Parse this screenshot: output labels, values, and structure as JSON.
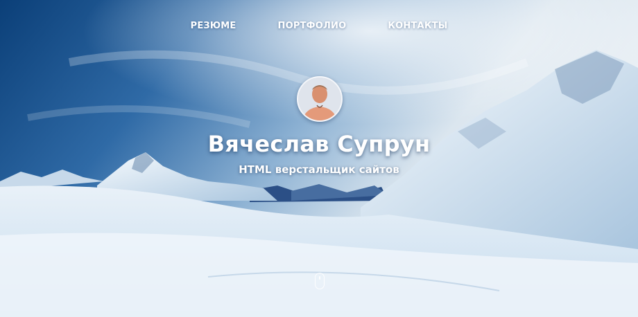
{
  "nav": {
    "items": [
      {
        "label": "РЕЗЮМЕ"
      },
      {
        "label": "ПОРТФОЛИО"
      },
      {
        "label": "КОНТАКТЫ"
      }
    ]
  },
  "profile": {
    "name": "Вячеслав Супрун",
    "role": "HTML верстальщик сайтов"
  },
  "colors": {
    "sky_dark": "#0b3f78",
    "sky_light": "#e6eef5",
    "snow": "#f2f7fc",
    "text": "#ffffff"
  },
  "icons": {
    "scroll": "mouse-scroll-icon"
  }
}
